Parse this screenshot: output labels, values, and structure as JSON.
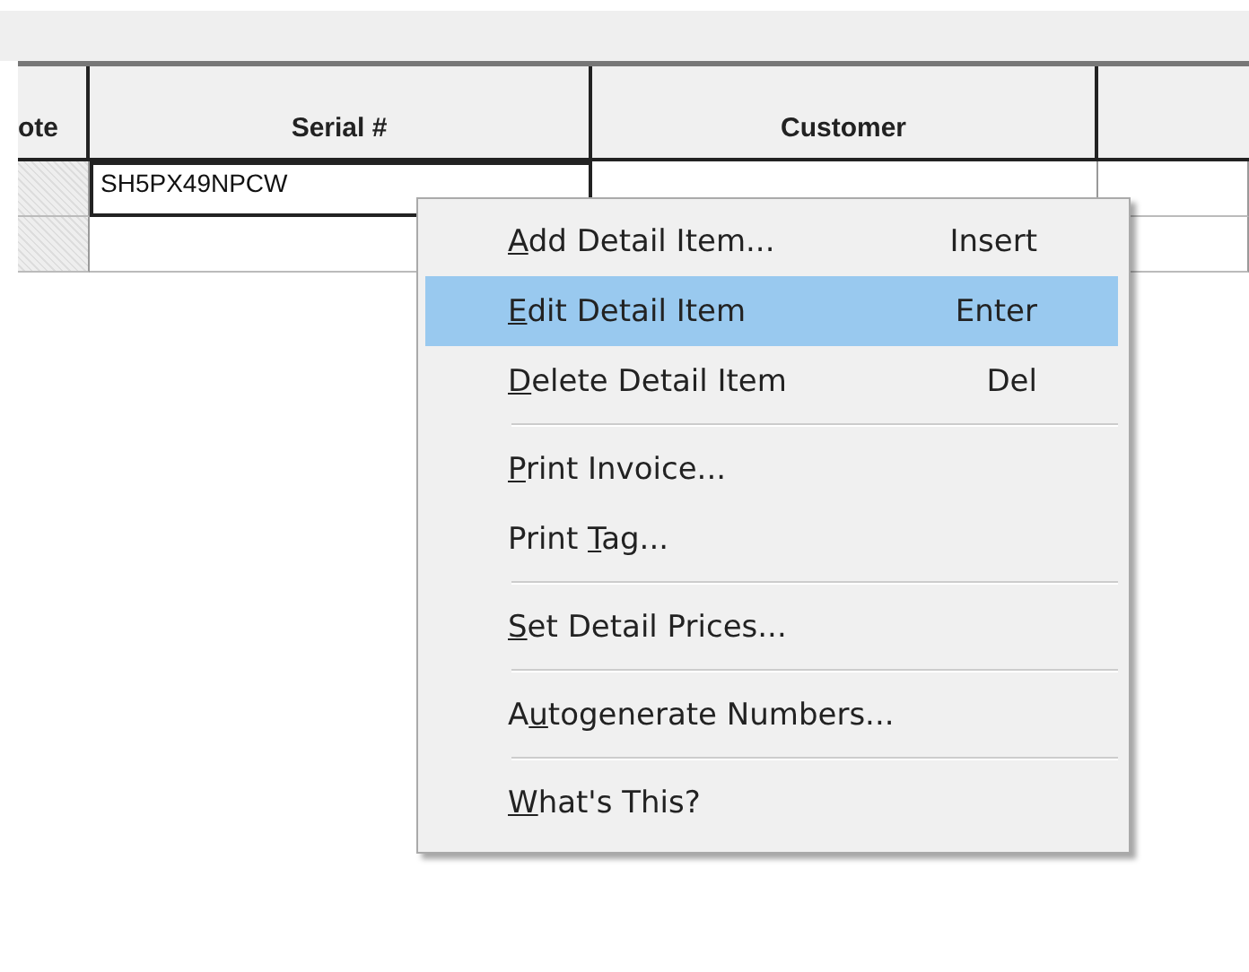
{
  "table": {
    "columns": [
      "ote",
      "Serial #",
      "Customer"
    ],
    "rows": [
      {
        "cells": [
          {},
          {
            "text": "SH5PX49NPCW",
            "focused": true
          },
          {},
          {}
        ]
      },
      {
        "cells": [
          {},
          {},
          {},
          {}
        ]
      }
    ]
  },
  "context_menu": {
    "groups": [
      [
        {
          "key": "A",
          "post": "dd Detail Item...",
          "shortcut": "Insert",
          "selected": false
        },
        {
          "key": "E",
          "post": "dit Detail Item",
          "shortcut": "Enter",
          "selected": true
        },
        {
          "key": "D",
          "post": "elete Detail Item",
          "shortcut": "Del",
          "selected": false
        }
      ],
      [
        {
          "key": "P",
          "post": "rint Invoice...",
          "selected": false
        },
        {
          "pre": "Print ",
          "key": "T",
          "post": "ag...",
          "selected": false
        }
      ],
      [
        {
          "key": "S",
          "post": "et Detail Prices...",
          "selected": false
        }
      ],
      [
        {
          "pre": "A",
          "key": "u",
          "post": "togenerate Numbers...",
          "selected": false
        }
      ],
      [
        {
          "key": "W",
          "post": "hat's This?",
          "selected": false
        }
      ]
    ]
  }
}
